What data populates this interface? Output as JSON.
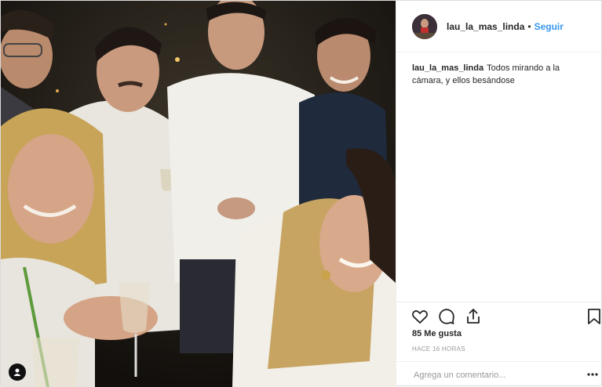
{
  "header": {
    "username": "lau_la_mas_linda",
    "separator": "•",
    "follow_label": "Seguir"
  },
  "caption": {
    "username": "lau_la_mas_linda",
    "text": "Todos mirando a la cámara, y ellos besándose"
  },
  "actions": {
    "icons": [
      "heart-icon",
      "comment-icon",
      "share-icon",
      "bookmark-icon"
    ]
  },
  "likes": "85 Me gusta",
  "timestamp": "HACE 16 HORAS",
  "comment": {
    "placeholder": "Agrega un comentario..."
  },
  "colors": {
    "follow_link": "#3897f0",
    "text": "#262626",
    "muted": "#999999",
    "border": "#efefef"
  }
}
